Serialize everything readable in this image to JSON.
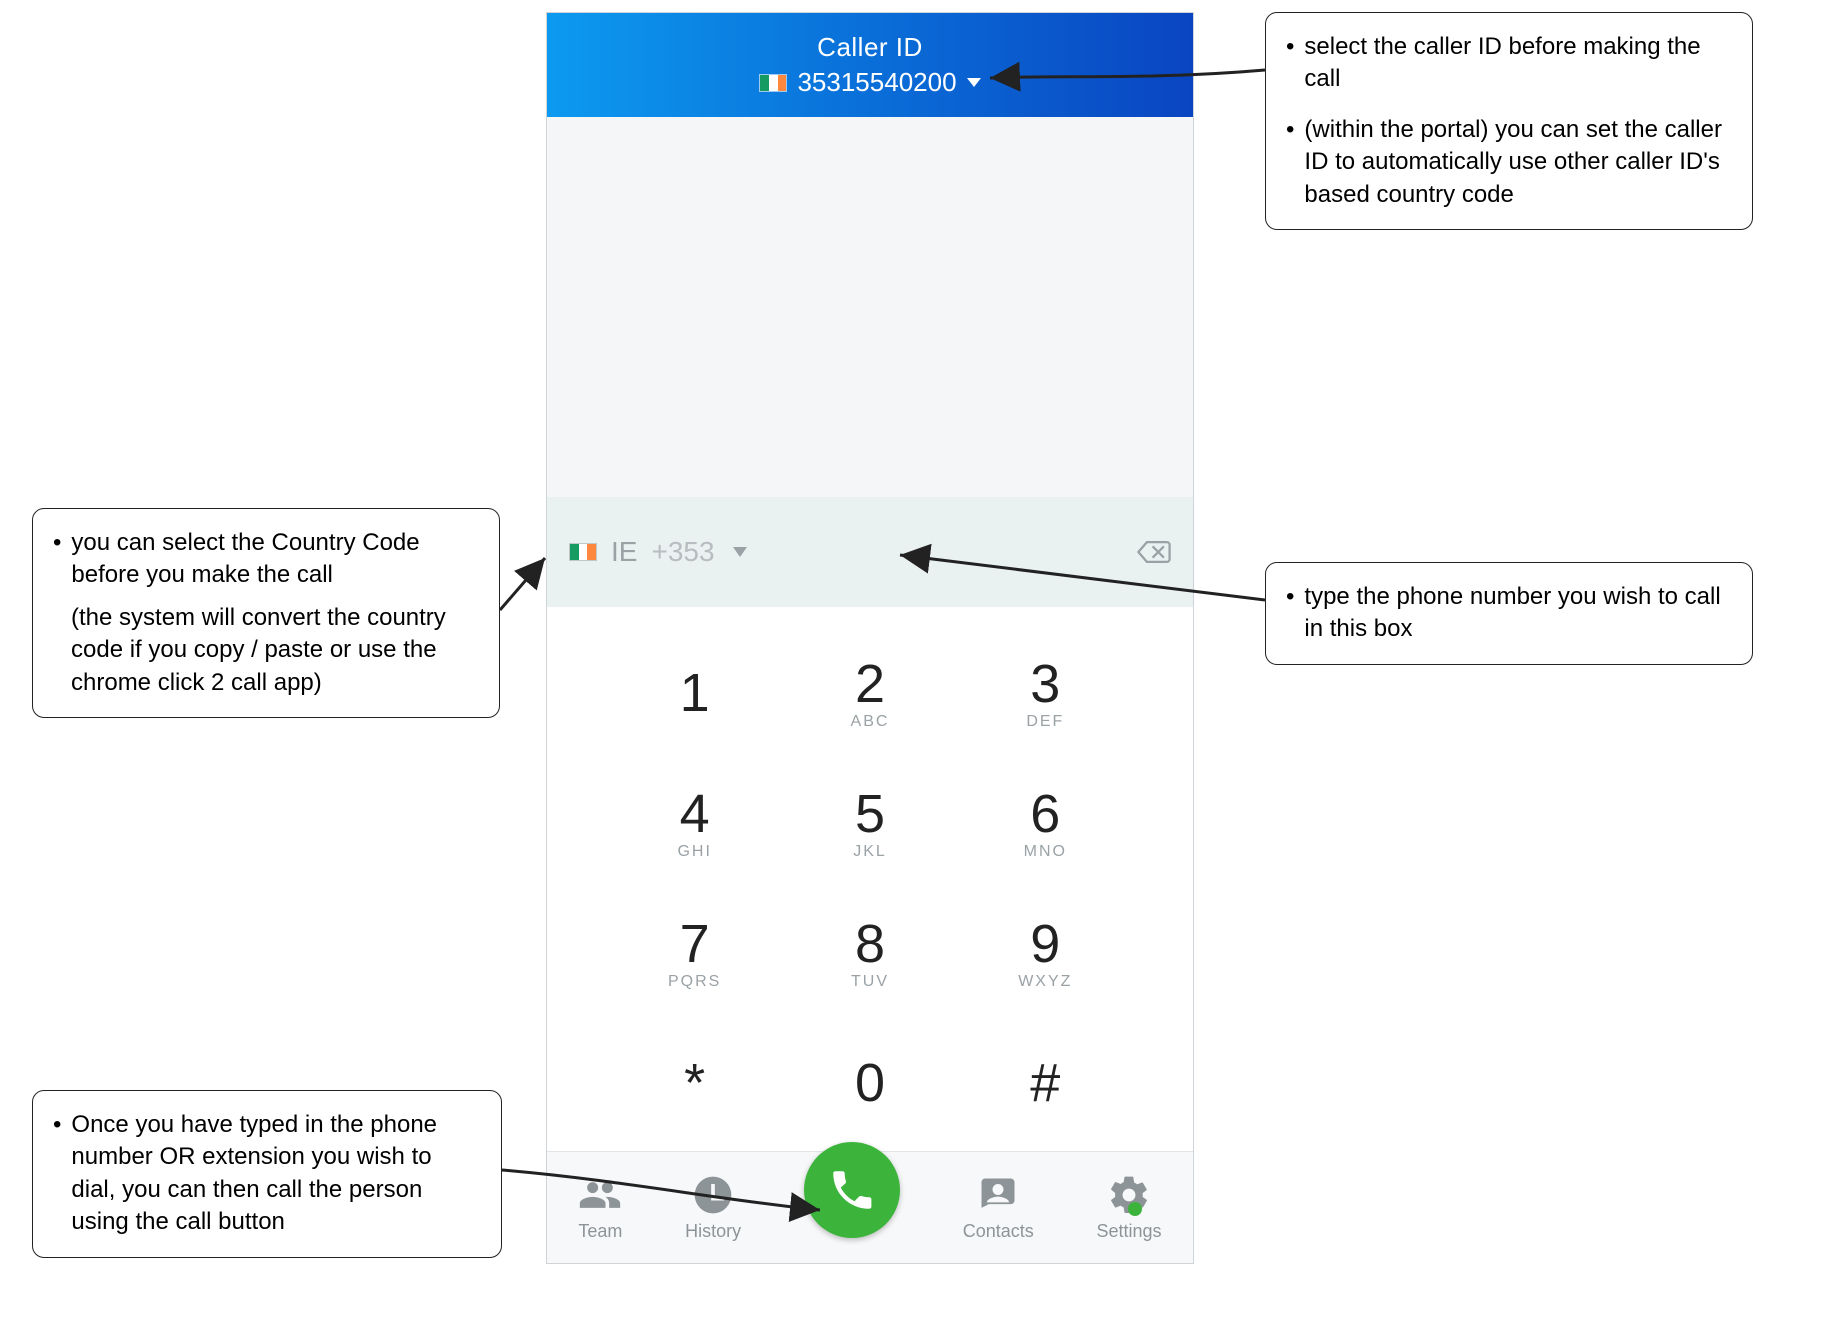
{
  "header": {
    "title": "Caller ID",
    "flag": "ie",
    "number": "35315540200"
  },
  "country_selector": {
    "flag": "ie",
    "code_label": "IE",
    "dial_code": "+353"
  },
  "keypad": [
    {
      "digit": "1",
      "letters": ""
    },
    {
      "digit": "2",
      "letters": "ABC"
    },
    {
      "digit": "3",
      "letters": "DEF"
    },
    {
      "digit": "4",
      "letters": "GHI"
    },
    {
      "digit": "5",
      "letters": "JKL"
    },
    {
      "digit": "6",
      "letters": "MNO"
    },
    {
      "digit": "7",
      "letters": "PQRS"
    },
    {
      "digit": "8",
      "letters": "TUV"
    },
    {
      "digit": "9",
      "letters": "WXYZ"
    },
    {
      "digit": "*",
      "letters": ""
    },
    {
      "digit": "0",
      "letters": ""
    },
    {
      "digit": "#",
      "letters": ""
    }
  ],
  "nav": {
    "team": "Team",
    "history": "History",
    "contacts": "Contacts",
    "settings": "Settings"
  },
  "callouts": {
    "caller_id_1": "select the caller ID before making the call",
    "caller_id_2": "(within the portal) you can set the caller ID to automatically use other caller ID's based country code",
    "number": "type the phone number you wish to call in this box",
    "country_main": "you can select the Country Code before you make the call",
    "country_sub": "(the system will convert the country code if you copy / paste or use the chrome click 2 call app)",
    "call_button": "Once you have typed in the phone number OR extension you wish to dial, you can then call the person using the call button"
  }
}
